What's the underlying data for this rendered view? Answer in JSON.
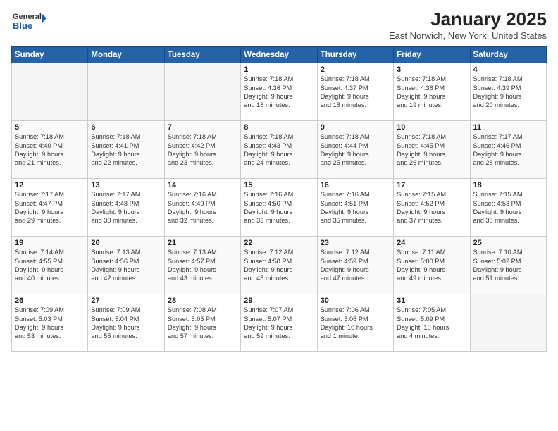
{
  "logo": {
    "line1": "General",
    "line2": "Blue"
  },
  "title": "January 2025",
  "subtitle": "East Norwich, New York, United States",
  "weekdays": [
    "Sunday",
    "Monday",
    "Tuesday",
    "Wednesday",
    "Thursday",
    "Friday",
    "Saturday"
  ],
  "weeks": [
    [
      {
        "day": "",
        "info": ""
      },
      {
        "day": "",
        "info": ""
      },
      {
        "day": "",
        "info": ""
      },
      {
        "day": "1",
        "info": "Sunrise: 7:18 AM\nSunset: 4:36 PM\nDaylight: 9 hours\nand 18 minutes."
      },
      {
        "day": "2",
        "info": "Sunrise: 7:18 AM\nSunset: 4:37 PM\nDaylight: 9 hours\nand 18 minutes."
      },
      {
        "day": "3",
        "info": "Sunrise: 7:18 AM\nSunset: 4:38 PM\nDaylight: 9 hours\nand 19 minutes."
      },
      {
        "day": "4",
        "info": "Sunrise: 7:18 AM\nSunset: 4:39 PM\nDaylight: 9 hours\nand 20 minutes."
      }
    ],
    [
      {
        "day": "5",
        "info": "Sunrise: 7:18 AM\nSunset: 4:40 PM\nDaylight: 9 hours\nand 21 minutes."
      },
      {
        "day": "6",
        "info": "Sunrise: 7:18 AM\nSunset: 4:41 PM\nDaylight: 9 hours\nand 22 minutes."
      },
      {
        "day": "7",
        "info": "Sunrise: 7:18 AM\nSunset: 4:42 PM\nDaylight: 9 hours\nand 23 minutes."
      },
      {
        "day": "8",
        "info": "Sunrise: 7:18 AM\nSunset: 4:43 PM\nDaylight: 9 hours\nand 24 minutes."
      },
      {
        "day": "9",
        "info": "Sunrise: 7:18 AM\nSunset: 4:44 PM\nDaylight: 9 hours\nand 25 minutes."
      },
      {
        "day": "10",
        "info": "Sunrise: 7:18 AM\nSunset: 4:45 PM\nDaylight: 9 hours\nand 26 minutes."
      },
      {
        "day": "11",
        "info": "Sunrise: 7:17 AM\nSunset: 4:46 PM\nDaylight: 9 hours\nand 28 minutes."
      }
    ],
    [
      {
        "day": "12",
        "info": "Sunrise: 7:17 AM\nSunset: 4:47 PM\nDaylight: 9 hours\nand 29 minutes."
      },
      {
        "day": "13",
        "info": "Sunrise: 7:17 AM\nSunset: 4:48 PM\nDaylight: 9 hours\nand 30 minutes."
      },
      {
        "day": "14",
        "info": "Sunrise: 7:16 AM\nSunset: 4:49 PM\nDaylight: 9 hours\nand 32 minutes."
      },
      {
        "day": "15",
        "info": "Sunrise: 7:16 AM\nSunset: 4:50 PM\nDaylight: 9 hours\nand 33 minutes."
      },
      {
        "day": "16",
        "info": "Sunrise: 7:16 AM\nSunset: 4:51 PM\nDaylight: 9 hours\nand 35 minutes."
      },
      {
        "day": "17",
        "info": "Sunrise: 7:15 AM\nSunset: 4:52 PM\nDaylight: 9 hours\nand 37 minutes."
      },
      {
        "day": "18",
        "info": "Sunrise: 7:15 AM\nSunset: 4:53 PM\nDaylight: 9 hours\nand 38 minutes."
      }
    ],
    [
      {
        "day": "19",
        "info": "Sunrise: 7:14 AM\nSunset: 4:55 PM\nDaylight: 9 hours\nand 40 minutes."
      },
      {
        "day": "20",
        "info": "Sunrise: 7:13 AM\nSunset: 4:56 PM\nDaylight: 9 hours\nand 42 minutes."
      },
      {
        "day": "21",
        "info": "Sunrise: 7:13 AM\nSunset: 4:57 PM\nDaylight: 9 hours\nand 43 minutes."
      },
      {
        "day": "22",
        "info": "Sunrise: 7:12 AM\nSunset: 4:58 PM\nDaylight: 9 hours\nand 45 minutes."
      },
      {
        "day": "23",
        "info": "Sunrise: 7:12 AM\nSunset: 4:59 PM\nDaylight: 9 hours\nand 47 minutes."
      },
      {
        "day": "24",
        "info": "Sunrise: 7:11 AM\nSunset: 5:00 PM\nDaylight: 9 hours\nand 49 minutes."
      },
      {
        "day": "25",
        "info": "Sunrise: 7:10 AM\nSunset: 5:02 PM\nDaylight: 9 hours\nand 51 minutes."
      }
    ],
    [
      {
        "day": "26",
        "info": "Sunrise: 7:09 AM\nSunset: 5:03 PM\nDaylight: 9 hours\nand 53 minutes."
      },
      {
        "day": "27",
        "info": "Sunrise: 7:09 AM\nSunset: 5:04 PM\nDaylight: 9 hours\nand 55 minutes."
      },
      {
        "day": "28",
        "info": "Sunrise: 7:08 AM\nSunset: 5:05 PM\nDaylight: 9 hours\nand 57 minutes."
      },
      {
        "day": "29",
        "info": "Sunrise: 7:07 AM\nSunset: 5:07 PM\nDaylight: 9 hours\nand 59 minutes."
      },
      {
        "day": "30",
        "info": "Sunrise: 7:06 AM\nSunset: 5:08 PM\nDaylight: 10 hours\nand 1 minute."
      },
      {
        "day": "31",
        "info": "Sunrise: 7:05 AM\nSunset: 5:09 PM\nDaylight: 10 hours\nand 4 minutes."
      },
      {
        "day": "",
        "info": ""
      }
    ]
  ]
}
